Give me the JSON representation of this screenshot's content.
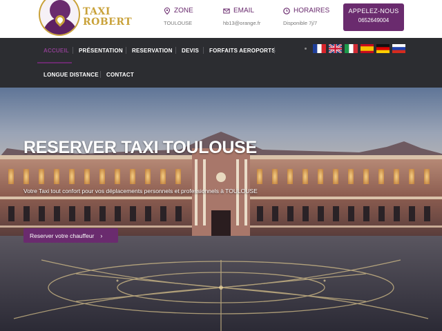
{
  "logo": {
    "line1": "TAXI",
    "line2": "ROBERT"
  },
  "header": {
    "zone": {
      "label": "ZONE",
      "value": "TOULOUSE",
      "icon": "map-pin-icon"
    },
    "email": {
      "label": "EMAIL",
      "value": "hb13@orange.fr",
      "icon": "envelope-icon"
    },
    "hours": {
      "label": "HORAIRES",
      "value": "Disponible 7j/7",
      "icon": "clock-icon"
    },
    "call": {
      "label": "APPELEZ-NOUS",
      "phone": "0652649004"
    }
  },
  "nav": {
    "items": [
      "ACCUEIL",
      "PRÉSENTATION",
      "RESERVATION",
      "DEVIS",
      "FORFAITS AEROPORTS",
      "LONGUE DISTANCE",
      "CONTACT"
    ],
    "active": "ACCUEIL",
    "flags": [
      "french-flag-icon",
      "uk-flag-icon",
      "italian-flag-icon",
      "spanish-flag-icon",
      "german-flag-icon",
      "russian-flag-icon"
    ]
  },
  "hero": {
    "title": "RESERVER TAXI TOULOUSE",
    "subtitle": "Votre Taxi tout confort pour vos déplacements personnels et professionnels à TOULOUSE",
    "cta": "Reserver votre chauffeur"
  },
  "colors": {
    "brand": "#6a2b6e",
    "gold": "#c9a23a",
    "nav_bg": "#2c2d31"
  }
}
